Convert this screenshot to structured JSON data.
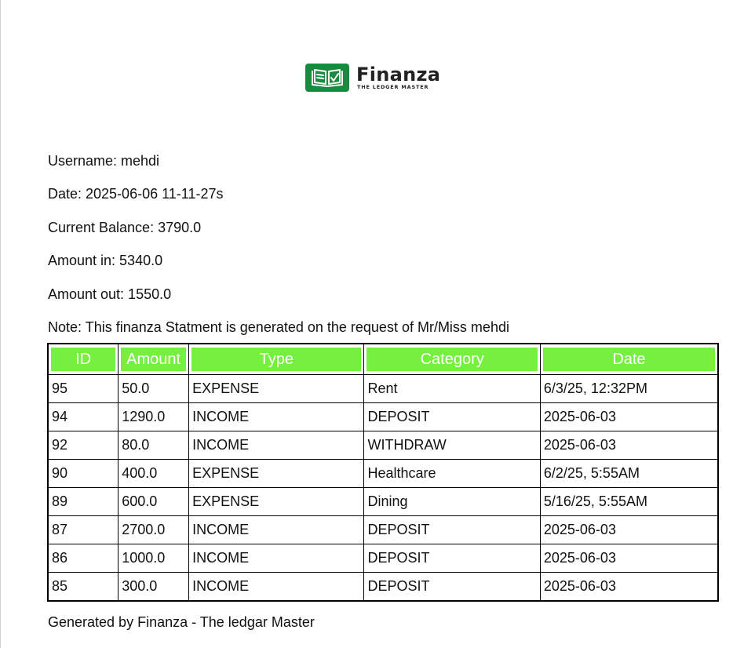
{
  "logo": {
    "name": "Finanza",
    "tagline": "THE LEDGER MASTER",
    "badge_color": "#1a8a3e"
  },
  "info": {
    "username": "Username: mehdi",
    "date": "Date: 2025-06-06 11-11-27s",
    "current_balance": "Current Balance: 3790.0",
    "amount_in": "Amount in: 5340.0",
    "amount_out": "Amount out: 1550.0",
    "note": "Note: This finanza Statment is generated on the request of Mr/Miss mehdi"
  },
  "table": {
    "header_color": "#76f03e",
    "headers": [
      "ID",
      "Amount",
      "Type",
      "Category",
      "Date"
    ],
    "rows": [
      [
        "95",
        "50.0",
        "EXPENSE",
        "Rent",
        "6/3/25, 12:32PM"
      ],
      [
        "94",
        "1290.0",
        "INCOME",
        "DEPOSIT",
        "2025-06-03"
      ],
      [
        "92",
        "80.0",
        "INCOME",
        "WITHDRAW",
        "2025-06-03"
      ],
      [
        "90",
        "400.0",
        "EXPENSE",
        "Healthcare",
        "6/2/25, 5:55AM"
      ],
      [
        "89",
        "600.0",
        "EXPENSE",
        "Dining",
        "5/16/25, 5:55AM"
      ],
      [
        "87",
        "2700.0",
        "INCOME",
        "DEPOSIT",
        "2025-06-03"
      ],
      [
        "86",
        "1000.0",
        "INCOME",
        "DEPOSIT",
        "2025-06-03"
      ],
      [
        "85",
        "300.0",
        "INCOME",
        "DEPOSIT",
        "2025-06-03"
      ]
    ]
  },
  "footer": "Generated by Finanza - The ledgar Master"
}
